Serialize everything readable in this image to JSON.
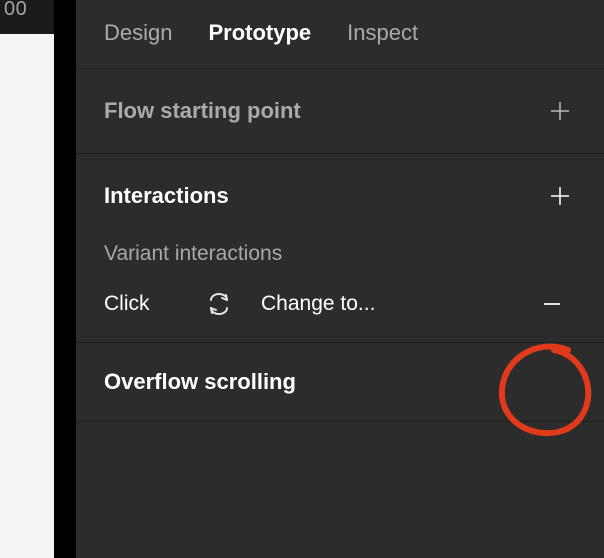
{
  "edge": {
    "ruler_text": "00"
  },
  "tabs": {
    "design": "Design",
    "prototype": "Prototype",
    "inspect": "Inspect"
  },
  "flow": {
    "title": "Flow starting point"
  },
  "interactions": {
    "title": "Interactions",
    "variant_sub": "Variant interactions",
    "row": {
      "trigger": "Click",
      "action": "Change to..."
    }
  },
  "overflow": {
    "title": "Overflow scrolling"
  }
}
